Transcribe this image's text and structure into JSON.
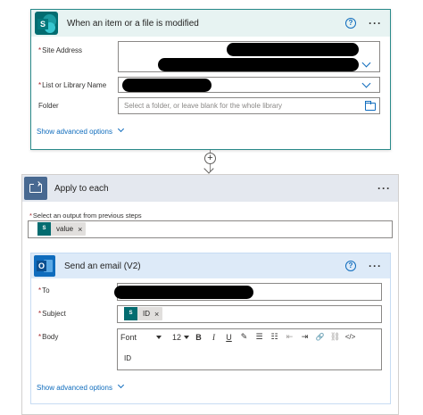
{
  "trigger": {
    "title": "When an item or a file is modified",
    "help_glyph": "?",
    "more_glyph": "···",
    "logo_letter": "S",
    "site_address_label": "Site Address",
    "list_label": "List or Library Name",
    "folder_label": "Folder",
    "folder_placeholder": "Select a folder, or leave blank for the whole library",
    "advanced_link": "Show advanced options"
  },
  "connector": {
    "plus_glyph": "+"
  },
  "apply_each": {
    "title": "Apply to each",
    "more_glyph": "···",
    "select_label": "Select an output from previous steps",
    "token_text": "value",
    "token_remove": "×",
    "token_logo": "S"
  },
  "email": {
    "title": "Send an email (V2)",
    "help_glyph": "?",
    "more_glyph": "···",
    "logo_letter": "O",
    "to_label": "To",
    "subject_label": "Subject",
    "subject_token": "ID",
    "subject_token_remove": "×",
    "body_label": "Body",
    "font_name": "Font",
    "font_size": "12",
    "bold": "B",
    "italic": "I",
    "underline": "U",
    "pen": "✎",
    "bullets": "☰",
    "numbered": "☷",
    "outdent": "⇤",
    "indent": "⇥",
    "link": "🔗",
    "unlink": "⛓",
    "code": "</>",
    "body_text": "ID",
    "advanced_link": "Show advanced options"
  },
  "required_mark": "*",
  "colors": {
    "accent": "#0f6cbd",
    "sharepoint": "#036c70",
    "loop": "#486991",
    "required": "#a4262c"
  }
}
